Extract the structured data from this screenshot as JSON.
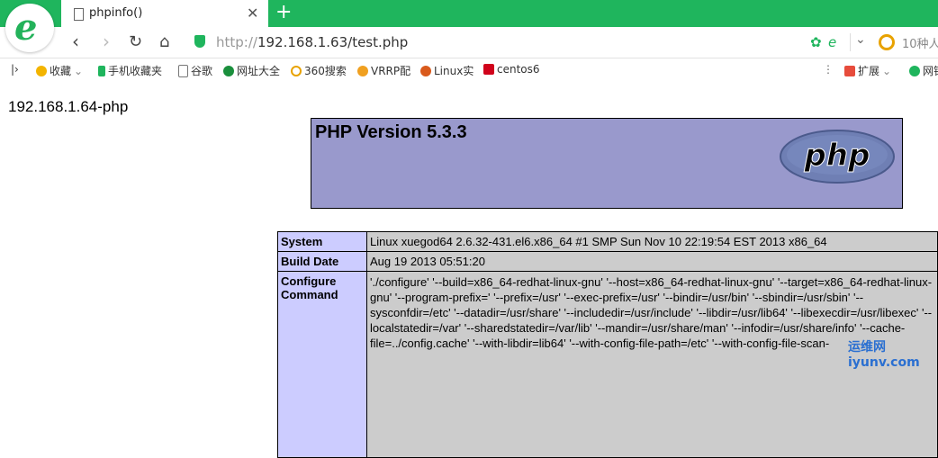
{
  "browser": {
    "tab_title": "phpinfo()",
    "url_protocol": "http://",
    "url_host": "192.168.1.63/test.php",
    "search_placeholder": "10种人",
    "bookmarks": [
      {
        "label": "收藏",
        "icon": "star-icon"
      },
      {
        "label": "手机收藏夹",
        "icon": "phone-icon"
      },
      {
        "label": "谷歌",
        "icon": "page-icon"
      },
      {
        "label": "网址大全",
        "icon": "nav-icon"
      },
      {
        "label": "360搜索",
        "icon": "search-360-icon"
      },
      {
        "label": "VRRP配",
        "icon": "fox-icon"
      },
      {
        "label": "Linux实",
        "icon": "firefox-icon"
      },
      {
        "label": "centos6",
        "icon": "c-icon"
      },
      {
        "label": "扩展",
        "icon": "grid-icon"
      },
      {
        "label": "网银",
        "icon": "bank-icon"
      }
    ]
  },
  "page": {
    "text": "192.168.1.64-php",
    "php_version": "PHP Version 5.3.3",
    "logo_text": "php"
  },
  "info_table": [
    {
      "key": "System",
      "value": "Linux xuegod64 2.6.32-431.el6.x86_64 #1 SMP Sun Nov 10 22:19:54 EST 2013 x86_64"
    },
    {
      "key": "Build Date",
      "value": "Aug 19 2013 05:51:20"
    },
    {
      "key": "Configure Command",
      "value": "'./configure' '--build=x86_64-redhat-linux-gnu' '--host=x86_64-redhat-linux-gnu' '--target=x86_64-redhat-linux-gnu' '--program-prefix=' '--prefix=/usr' '--exec-prefix=/usr' '--bindir=/usr/bin' '--sbindir=/usr/sbin' '--sysconfdir=/etc' '--datadir=/usr/share' '--includedir=/usr/include' '--libdir=/usr/lib64' '--libexecdir=/usr/libexec' '--localstatedir=/var' '--sharedstatedir=/var/lib' '--mandir=/usr/share/man' '--infodir=/usr/share/info' '--cache-file=../config.cache' '--with-libdir=lib64' '--with-config-file-path=/etc' '--with-config-file-scan-"
    }
  ],
  "watermark": "运维网 iyunv.com"
}
